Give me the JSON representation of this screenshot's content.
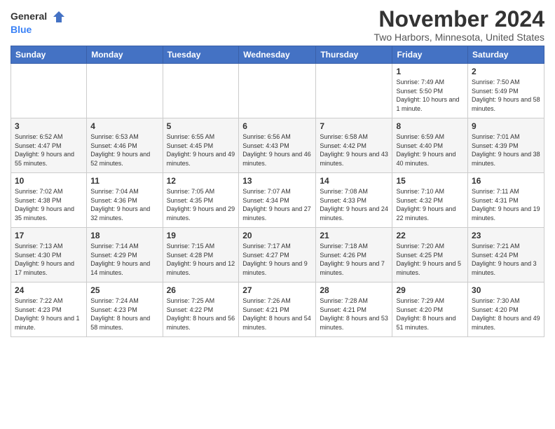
{
  "header": {
    "logo_general": "General",
    "logo_blue": "Blue",
    "title": "November 2024",
    "location": "Two Harbors, Minnesota, United States"
  },
  "days_of_week": [
    "Sunday",
    "Monday",
    "Tuesday",
    "Wednesday",
    "Thursday",
    "Friday",
    "Saturday"
  ],
  "weeks": [
    [
      {
        "day": "",
        "info": ""
      },
      {
        "day": "",
        "info": ""
      },
      {
        "day": "",
        "info": ""
      },
      {
        "day": "",
        "info": ""
      },
      {
        "day": "",
        "info": ""
      },
      {
        "day": "1",
        "info": "Sunrise: 7:49 AM\nSunset: 5:50 PM\nDaylight: 10 hours and 1 minute."
      },
      {
        "day": "2",
        "info": "Sunrise: 7:50 AM\nSunset: 5:49 PM\nDaylight: 9 hours and 58 minutes."
      }
    ],
    [
      {
        "day": "3",
        "info": "Sunrise: 6:52 AM\nSunset: 4:47 PM\nDaylight: 9 hours and 55 minutes."
      },
      {
        "day": "4",
        "info": "Sunrise: 6:53 AM\nSunset: 4:46 PM\nDaylight: 9 hours and 52 minutes."
      },
      {
        "day": "5",
        "info": "Sunrise: 6:55 AM\nSunset: 4:45 PM\nDaylight: 9 hours and 49 minutes."
      },
      {
        "day": "6",
        "info": "Sunrise: 6:56 AM\nSunset: 4:43 PM\nDaylight: 9 hours and 46 minutes."
      },
      {
        "day": "7",
        "info": "Sunrise: 6:58 AM\nSunset: 4:42 PM\nDaylight: 9 hours and 43 minutes."
      },
      {
        "day": "8",
        "info": "Sunrise: 6:59 AM\nSunset: 4:40 PM\nDaylight: 9 hours and 40 minutes."
      },
      {
        "day": "9",
        "info": "Sunrise: 7:01 AM\nSunset: 4:39 PM\nDaylight: 9 hours and 38 minutes."
      }
    ],
    [
      {
        "day": "10",
        "info": "Sunrise: 7:02 AM\nSunset: 4:38 PM\nDaylight: 9 hours and 35 minutes."
      },
      {
        "day": "11",
        "info": "Sunrise: 7:04 AM\nSunset: 4:36 PM\nDaylight: 9 hours and 32 minutes."
      },
      {
        "day": "12",
        "info": "Sunrise: 7:05 AM\nSunset: 4:35 PM\nDaylight: 9 hours and 29 minutes."
      },
      {
        "day": "13",
        "info": "Sunrise: 7:07 AM\nSunset: 4:34 PM\nDaylight: 9 hours and 27 minutes."
      },
      {
        "day": "14",
        "info": "Sunrise: 7:08 AM\nSunset: 4:33 PM\nDaylight: 9 hours and 24 minutes."
      },
      {
        "day": "15",
        "info": "Sunrise: 7:10 AM\nSunset: 4:32 PM\nDaylight: 9 hours and 22 minutes."
      },
      {
        "day": "16",
        "info": "Sunrise: 7:11 AM\nSunset: 4:31 PM\nDaylight: 9 hours and 19 minutes."
      }
    ],
    [
      {
        "day": "17",
        "info": "Sunrise: 7:13 AM\nSunset: 4:30 PM\nDaylight: 9 hours and 17 minutes."
      },
      {
        "day": "18",
        "info": "Sunrise: 7:14 AM\nSunset: 4:29 PM\nDaylight: 9 hours and 14 minutes."
      },
      {
        "day": "19",
        "info": "Sunrise: 7:15 AM\nSunset: 4:28 PM\nDaylight: 9 hours and 12 minutes."
      },
      {
        "day": "20",
        "info": "Sunrise: 7:17 AM\nSunset: 4:27 PM\nDaylight: 9 hours and 9 minutes."
      },
      {
        "day": "21",
        "info": "Sunrise: 7:18 AM\nSunset: 4:26 PM\nDaylight: 9 hours and 7 minutes."
      },
      {
        "day": "22",
        "info": "Sunrise: 7:20 AM\nSunset: 4:25 PM\nDaylight: 9 hours and 5 minutes."
      },
      {
        "day": "23",
        "info": "Sunrise: 7:21 AM\nSunset: 4:24 PM\nDaylight: 9 hours and 3 minutes."
      }
    ],
    [
      {
        "day": "24",
        "info": "Sunrise: 7:22 AM\nSunset: 4:23 PM\nDaylight: 9 hours and 1 minute."
      },
      {
        "day": "25",
        "info": "Sunrise: 7:24 AM\nSunset: 4:23 PM\nDaylight: 8 hours and 58 minutes."
      },
      {
        "day": "26",
        "info": "Sunrise: 7:25 AM\nSunset: 4:22 PM\nDaylight: 8 hours and 56 minutes."
      },
      {
        "day": "27",
        "info": "Sunrise: 7:26 AM\nSunset: 4:21 PM\nDaylight: 8 hours and 54 minutes."
      },
      {
        "day": "28",
        "info": "Sunrise: 7:28 AM\nSunset: 4:21 PM\nDaylight: 8 hours and 53 minutes."
      },
      {
        "day": "29",
        "info": "Sunrise: 7:29 AM\nSunset: 4:20 PM\nDaylight: 8 hours and 51 minutes."
      },
      {
        "day": "30",
        "info": "Sunrise: 7:30 AM\nSunset: 4:20 PM\nDaylight: 8 hours and 49 minutes."
      }
    ]
  ]
}
